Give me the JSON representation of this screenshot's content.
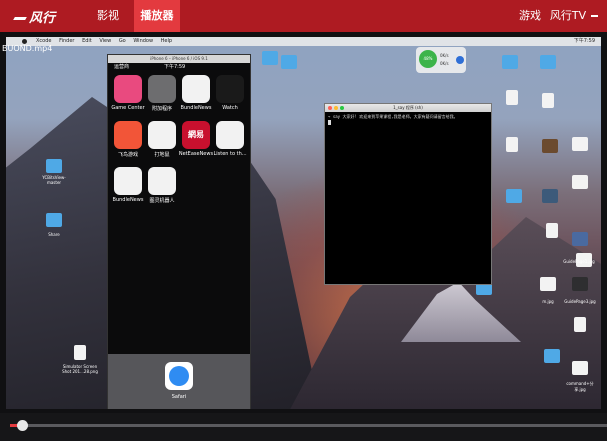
{
  "player": {
    "brand": "风行",
    "nav": {
      "library": "影视库",
      "player": "播放器",
      "games": "游戏",
      "tv": "风行TV"
    },
    "filename": "BUOND.mp4",
    "progress": 0.02,
    "accent": "#ae1b22",
    "accent_active": "#e33a3f"
  },
  "desktop": {
    "menubar": {
      "app": "Xcode",
      "items": [
        "Finder",
        "Edit",
        "View",
        "Go",
        "Window",
        "Help"
      ],
      "clock": "下午7:59"
    },
    "icons": [
      {
        "label": "YCBitsView-master"
      },
      {
        "label": "Share"
      },
      {
        "label": "Simulator Screen Shot 201...28.png"
      },
      {
        "label": "m.jpg"
      },
      {
        "label": "GuidePage3.jpg"
      },
      {
        "label": "GuidePage1.jpg"
      },
      {
        "label": "command+分享.jpg"
      }
    ]
  },
  "simulator": {
    "window_title": "iPhone 6 – iPhone 6 / iOS 9.1",
    "carrier": "运营商",
    "time": "下午7:59",
    "apps": [
      {
        "name": "Game Center",
        "color": "#e94a7f"
      },
      {
        "name": "附加程序",
        "color": "#6d6d6f"
      },
      {
        "name": "BundleNews",
        "color": "#f2f2f2"
      },
      {
        "name": "Watch",
        "color": "#1a1a1a"
      },
      {
        "name": "飞鸟游戏",
        "color": "#f25538"
      },
      {
        "name": "打地鼠",
        "color": "#f2f2f2"
      },
      {
        "name": "NetEaseNews",
        "color": "#c8102e"
      },
      {
        "name": "Listen to th...",
        "color": "#f2f2f2"
      },
      {
        "name": "BundleNews",
        "color": "#f2f2f2"
      },
      {
        "name": "图灵机器人",
        "color": "#f2f2f2"
      }
    ],
    "dock_app": "Safari",
    "netease_logo": "網易"
  },
  "terminal": {
    "title": "1_say 程序 (sh)",
    "line": "→ say 大家好! 欢迎来到苹果课程,我是老师。大家有疑问请留言给我。"
  },
  "network_widget": {
    "percent": "48%",
    "up": "0K/s",
    "down": "0K/s"
  }
}
